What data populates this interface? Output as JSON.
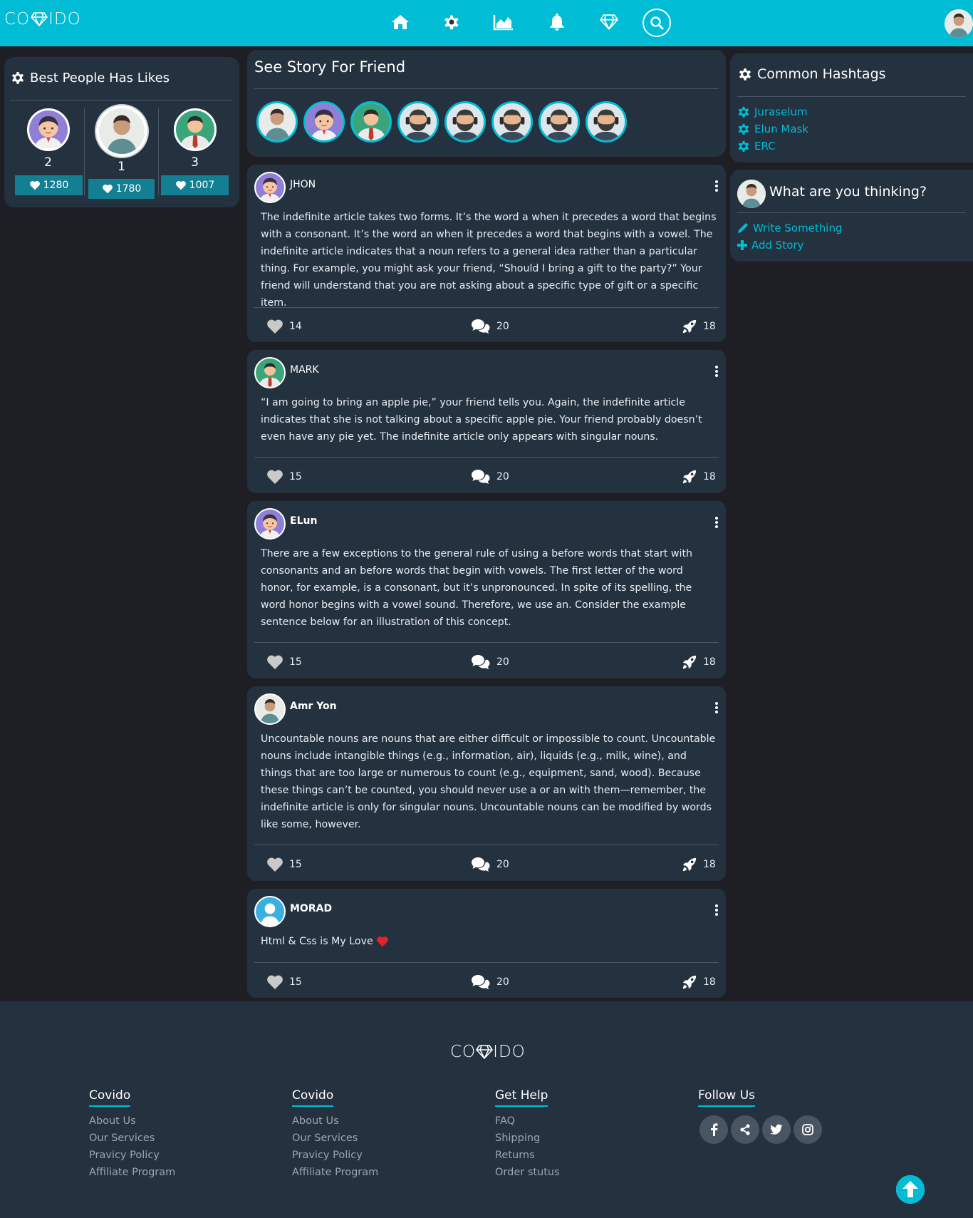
{
  "header": {
    "logo_left": "CO",
    "logo_right": "IDO",
    "nav": [
      "home-icon",
      "cog-icon",
      "chart-icon",
      "bell-icon",
      "diamond-icon",
      "search-icon"
    ]
  },
  "best_people": {
    "title": "Best People Has Likes",
    "items": [
      {
        "rank": "2",
        "likes": "1280"
      },
      {
        "rank": "1",
        "likes": "1780"
      },
      {
        "rank": "3",
        "likes": "1007"
      }
    ]
  },
  "stories": {
    "title": "See Story For Friend"
  },
  "posts": [
    {
      "name": "JHON",
      "text": "The indefinite article takes two forms. It’s the word a when it precedes a word that begins with a consonant. It’s the word an when it precedes a word that begins with a vowel. The indefinite article indicates that a noun refers to a general idea rather than a particular thing. For example, you might ask your friend, “Should I bring a gift to the party?” Your friend will understand that you are not asking about a specific type of gift or a specific item.",
      "likes": "14",
      "comments": "20",
      "shares": "18"
    },
    {
      "name": "MARK",
      "text": "“I am going to bring an apple pie,” your friend tells you. Again, the indefinite article indicates that she is not talking about a specific apple pie. Your friend probably doesn’t even have any pie yet. The indefinite article only appears with singular nouns.",
      "likes": "15",
      "comments": "20",
      "shares": "18"
    },
    {
      "name": "ELun",
      "text": "There are a few exceptions to the general rule of using a before words that start with consonants and an before words that begin with vowels. The first letter of the word honor, for example, is a consonant, but it’s unpronounced. In spite of its spelling, the word honor begins with a vowel sound. Therefore, we use an. Consider the example sentence below for an illustration of this concept.",
      "likes": "15",
      "comments": "20",
      "shares": "18"
    },
    {
      "name": "Amr Yon",
      "text": "Uncountable nouns are nouns that are either difficult or impossible to count. Uncountable nouns include intangible things (e.g., information, air), liquids (e.g., milk, wine), and things that are too large or numerous to count (e.g., equipment, sand, wood). Because these things can’t be counted, you should never use a or an with them—remember, the indefinite article is only for singular nouns. Uncountable nouns can be modified by words like some, however.",
      "likes": "15",
      "comments": "20",
      "shares": "18"
    },
    {
      "name": "MORAD",
      "text": "Html & Css is My Love",
      "likes": "15",
      "comments": "20",
      "shares": "18"
    }
  ],
  "hashtags": {
    "title": "Common Hashtags",
    "items": [
      "Juraselum",
      "Elun Mask",
      "ERC"
    ]
  },
  "thinking": {
    "title": "What are you thinking?",
    "write": "Write Something",
    "add": "Add Story"
  },
  "footer": {
    "logo_left": "CO",
    "logo_right": "IDO",
    "columns": [
      {
        "title": "Covido",
        "links": [
          "About Us",
          "Our Services",
          "Pravicy Policy",
          "Affiliate Program"
        ]
      },
      {
        "title": "Covido",
        "links": [
          "About Us",
          "Our Services",
          "Pravicy Policy",
          "Affiliate Program"
        ]
      },
      {
        "title": "Get Help",
        "links": [
          "FAQ",
          "Shipping",
          "Returns",
          "Order stutus"
        ]
      }
    ],
    "follow_title": "Follow Us",
    "social": [
      "facebook-icon",
      "share-icon",
      "twitter-icon",
      "instagram-icon"
    ]
  },
  "colors": {
    "accent": "#00bcd4",
    "panel": "#24313f",
    "background": "#1d1f25",
    "badge": "#137f92"
  }
}
